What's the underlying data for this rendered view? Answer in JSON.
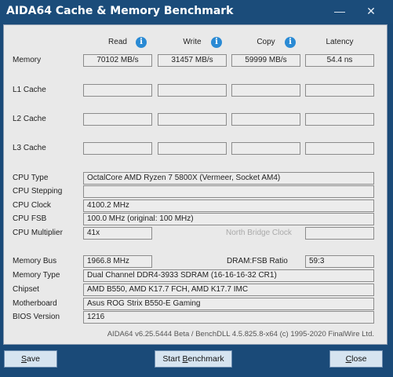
{
  "window": {
    "title": "AIDA64 Cache & Memory Benchmark",
    "minimize_glyph": "—",
    "close_glyph": "✕"
  },
  "columns": {
    "read": "Read",
    "write": "Write",
    "copy": "Copy",
    "latency": "Latency",
    "info_glyph": "i"
  },
  "rows": {
    "memory": {
      "label": "Memory",
      "read": "70102 MB/s",
      "write": "31457 MB/s",
      "copy": "59999 MB/s",
      "latency": "54.4 ns"
    },
    "l1": {
      "label": "L1 Cache"
    },
    "l2": {
      "label": "L2 Cache"
    },
    "l3": {
      "label": "L3 Cache"
    }
  },
  "cpu": {
    "type_label": "CPU Type",
    "type_value": "OctalCore AMD Ryzen 7 5800X  (Vermeer, Socket AM4)",
    "stepping_label": "CPU Stepping",
    "stepping_value": "",
    "clock_label": "CPU Clock",
    "clock_value": "4100.2 MHz",
    "fsb_label": "CPU FSB",
    "fsb_value": "100.0 MHz  (original: 100 MHz)",
    "multiplier_label": "CPU Multiplier",
    "multiplier_value": "41x",
    "nb_clock_label": "North Bridge Clock",
    "nb_clock_value": ""
  },
  "system": {
    "membus_label": "Memory Bus",
    "membus_value": "1966.8 MHz",
    "ratio_label": "DRAM:FSB Ratio",
    "ratio_value": "59:3",
    "memtype_label": "Memory Type",
    "memtype_value": "Dual Channel DDR4-3933 SDRAM  (16-16-16-32 CR1)",
    "chipset_label": "Chipset",
    "chipset_value": "AMD B550, AMD K17.7 FCH, AMD K17.7 IMC",
    "motherboard_label": "Motherboard",
    "motherboard_value": "Asus ROG Strix B550-E Gaming",
    "bios_label": "BIOS Version",
    "bios_value": "1216"
  },
  "footer": "AIDA64 v6.25.5444 Beta / BenchDLL 4.5.825.8-x64  (c) 1995-2020 FinalWire Ltd.",
  "buttons": {
    "save_first": "S",
    "save_rest": "ave",
    "start_prefix": "Start ",
    "start_accel": "B",
    "start_rest": "enchmark",
    "close_first": "C",
    "close_rest": "lose"
  },
  "colors": {
    "titlebar": "#1b4c7a",
    "panel": "#e9e9e9",
    "info": "#2a8ad4",
    "button": "#d6e4f0"
  }
}
